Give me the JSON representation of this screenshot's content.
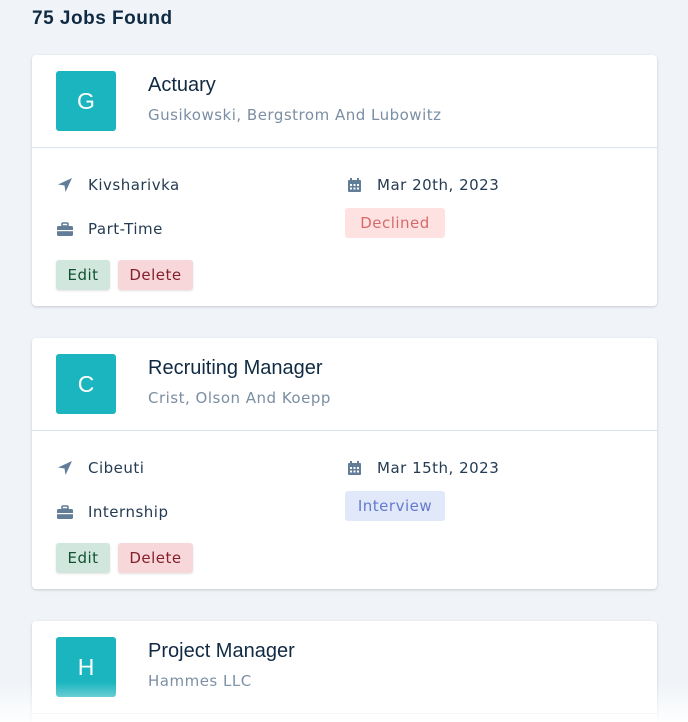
{
  "heading": "75 Jobs Found",
  "colors": {
    "avatar_bg": "#1ab5bf",
    "declined_bg": "#fee2e2",
    "declined_text": "#d66a6a",
    "interview_bg": "#e0e8f9",
    "interview_text": "#647acb",
    "edit_bg": "#d1e7dd",
    "delete_bg": "#f8d7da"
  },
  "jobs": [
    {
      "initial": "G",
      "title": "Actuary",
      "company": "Gusikowski, Bergstrom And Lubowitz",
      "location": "Kivsharivka",
      "date": "Mar 20th, 2023",
      "job_type": "Part-Time",
      "status": "Declined",
      "edit_label": "Edit",
      "delete_label": "Delete"
    },
    {
      "initial": "C",
      "title": "Recruiting Manager",
      "company": "Crist, Olson And Koepp",
      "location": "Cibeuti",
      "date": "Mar 15th, 2023",
      "job_type": "Internship",
      "status": "Interview",
      "edit_label": "Edit",
      "delete_label": "Delete"
    },
    {
      "initial": "H",
      "title": "Project Manager",
      "company": "Hammes LLC"
    }
  ]
}
